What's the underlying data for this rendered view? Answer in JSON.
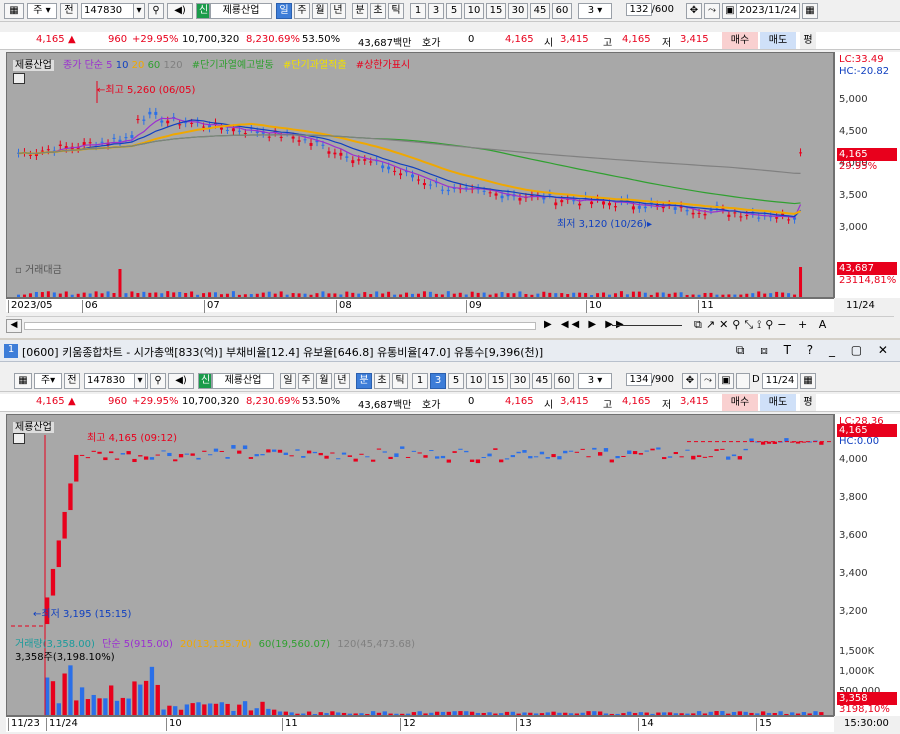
{
  "colors": {
    "up": "#e8001c",
    "down": "#2a6fe8",
    "ma5": "#9b30d0",
    "ma10": "#1040c0",
    "ma20": "#f0a800",
    "ma60": "#30a030",
    "ma120": "#808080",
    "bg": "#a8a8a8"
  },
  "top": {
    "toolbar": {
      "market": "주",
      "jeon": "전",
      "code": "147830",
      "badge": "신",
      "name": "제룡산업",
      "periods": [
        "일",
        "주",
        "월",
        "년",
        "분",
        "초",
        "틱"
      ],
      "active_period": "일",
      "nums": [
        "1",
        "3",
        "5",
        "10",
        "15",
        "30",
        "45",
        "60"
      ],
      "unit": "3",
      "count": "132",
      "count_total": "/600",
      "date": "2023/11/24"
    },
    "quote": {
      "price": "4,165",
      "arrow": "▲",
      "change": "960",
      "pct": "+29.95%",
      "volume": "10,700,320",
      "vol_pct": "8,230.69%",
      "ratio": "53.50%",
      "amount": "43,687백만",
      "hoga": "호가",
      "hoga_val": "0",
      "cur": "4,165",
      "open_l": "시",
      "open": "3,415",
      "high_l": "고",
      "high": "4,165",
      "low_l": "저",
      "low": "3,415",
      "buy": "매수",
      "sell": "매도",
      "flat": "평"
    },
    "legend": {
      "name": "제룡산업",
      "ma_label": "종가 단순 5",
      "ma10": "10",
      "ma20": "20",
      "ma60": "60",
      "ma120": "120",
      "l1": "#단기과열예고발동",
      "l2": "#단기과열적출",
      "l3": "#상한가표시"
    },
    "hc": {
      "lc": "LC:33.49",
      "hc": "HC:-20.82"
    },
    "max_label": "최고 5,260 (06/05)",
    "min_label": "최저 3,120 (10/26)",
    "vol_label": "거래대금",
    "price_ticks": [
      "5,000",
      "4,500",
      "4,000",
      "3,500",
      "3,000"
    ],
    "price_badge": "4,165",
    "price_badge_pct": "29.95%",
    "vol_badge": "43,687",
    "vol_badge2": "23114,81%",
    "x_labels": [
      "2023/05",
      "06",
      "07",
      "08",
      "09",
      "10",
      "11"
    ],
    "x_right": "11/24"
  },
  "bottom": {
    "title": "[0600] 키움종합차트 - 시가총액[833(억)] 부채비율[12.4] 유보율[646.8] 유통비율[47.0] 유통수[9,396(천)]",
    "toolbar": {
      "market": "주",
      "jeon": "전",
      "code": "147830",
      "badge": "신",
      "name": "제룡산업",
      "periods": [
        "일",
        "주",
        "월",
        "년",
        "분",
        "초",
        "틱"
      ],
      "active_period": "분",
      "nums": [
        "1",
        "3",
        "5",
        "10",
        "15",
        "30",
        "45",
        "60"
      ],
      "active_num": "3",
      "unit": "3",
      "count": "134",
      "count_total": "/900",
      "d_label": "D",
      "date": "11/24"
    },
    "quote": {
      "price": "4,165",
      "arrow": "▲",
      "change": "960",
      "pct": "+29.95%",
      "volume": "10,700,320",
      "vol_pct": "8,230.69%",
      "ratio": "53.50%",
      "amount": "43,687백만",
      "hoga": "호가",
      "hoga_val": "0",
      "cur": "4,165",
      "open_l": "시",
      "open": "3,415",
      "high_l": "고",
      "high": "4,165",
      "low_l": "저",
      "low": "3,415",
      "buy": "매수",
      "sell": "매도",
      "flat": "평"
    },
    "legend": {
      "name": "제룡산업"
    },
    "hc": {
      "lc": "LC:28.36",
      "hc": "HC:0.00"
    },
    "max_label": "최고 4,165 (09:12)",
    "min_label": "최저 3,195 (15:15)",
    "vol_legend": {
      "v": "거래량(3,358.00)",
      "m5": "단순 5(915.00)",
      "m20": "20(13,135.70)",
      "m60": "60(19,560.07)",
      "m120": "120(45,473.68)",
      "sub": "3,358주(3,198.10%)"
    },
    "price_ticks": [
      "4,000",
      "3,800",
      "3,600",
      "3,400",
      "3,200"
    ],
    "price_badge": "4,165",
    "price_badge_pct": "0.00%",
    "vol_ticks": [
      "1,500K",
      "1,000K",
      "500,000"
    ],
    "vol_badge": "3,358",
    "vol_badge2": "3198,10%",
    "x_labels": [
      "11/23",
      "11/24",
      "10",
      "11",
      "12",
      "13",
      "14",
      "15"
    ],
    "x_right": "15:30:00"
  }
}
